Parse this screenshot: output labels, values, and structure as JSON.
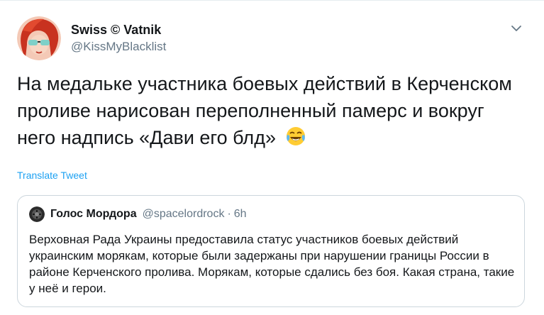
{
  "author": {
    "display_name": "Swiss © Vatnik",
    "handle": "@KissMyBlacklist",
    "avatar_icon": "red-haired-cartoon-avatar"
  },
  "tweet": {
    "text": "На медальке участника боевых действий в Керченском проливе нарисован переполненный памерс и вокруг него надпись «Дави его блд»",
    "emoji_icon": "face-with-tears-of-joy-icon",
    "translate_label": "Translate Tweet"
  },
  "quote": {
    "display_name": "Голос Мордора",
    "handle": "@spacelordrock",
    "separator": "·",
    "time": "6h",
    "text": "Верховная Рада Украины предоставила статус участников боевых действий украинским морякам, которые были задержаны при нарушении границы России в районе Керченского пролива. Морякам, которые сдались без боя. Какая страна, такие у неё и герои.",
    "avatar_icon": "dark-round-avatar"
  },
  "colors": {
    "link": "#1da1f2",
    "secondary_text": "#657786",
    "border": "#ccd6dd"
  }
}
